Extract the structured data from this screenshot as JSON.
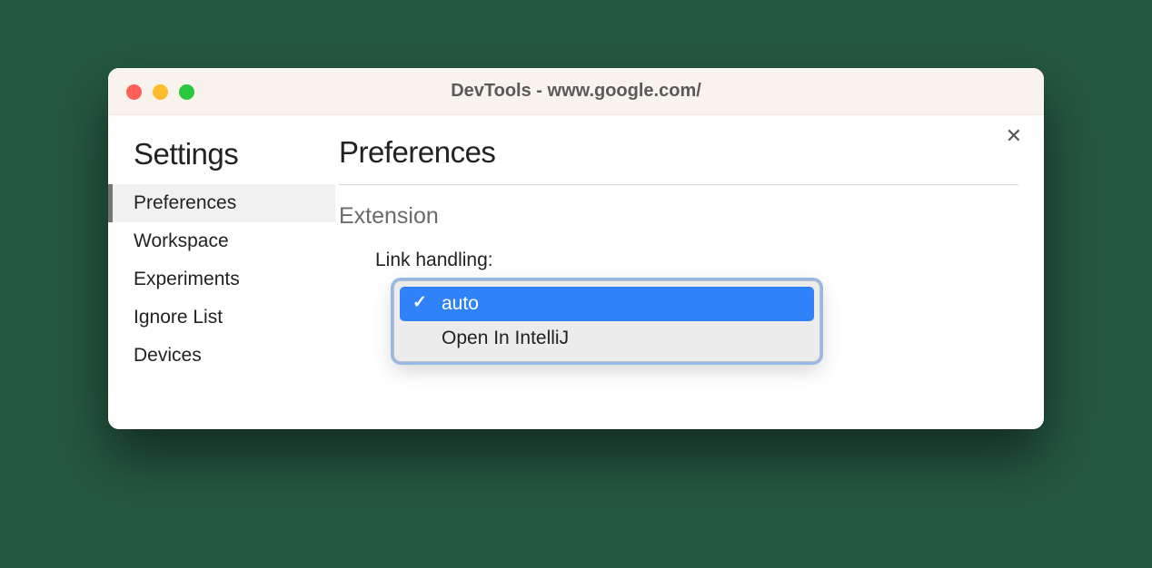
{
  "window": {
    "title": "DevTools - www.google.com/"
  },
  "sidebar": {
    "title": "Settings",
    "items": [
      {
        "label": "Preferences",
        "active": true
      },
      {
        "label": "Workspace",
        "active": false
      },
      {
        "label": "Experiments",
        "active": false
      },
      {
        "label": "Ignore List",
        "active": false
      },
      {
        "label": "Devices",
        "active": false
      }
    ]
  },
  "main": {
    "title": "Preferences",
    "section": "Extension",
    "setting_label": "Link handling:",
    "dropdown": {
      "options": [
        {
          "label": "auto",
          "selected": true
        },
        {
          "label": "Open In IntelliJ",
          "selected": false
        }
      ]
    }
  },
  "close_symbol": "✕"
}
